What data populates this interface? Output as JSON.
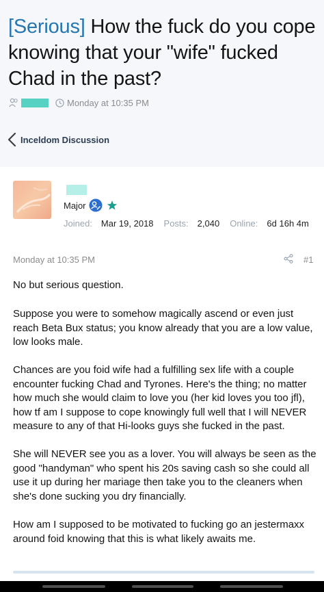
{
  "thread": {
    "prefix": "[Serious]",
    "title": " How the fuck do you cope knowing that your \"wife\" fucked Chad in the past?",
    "date": "Monday at 10:35 PM"
  },
  "breadcrumb": {
    "label": "Inceldom Discussion"
  },
  "author": {
    "rank": "Major",
    "stats": [
      {
        "label": "Joined:",
        "value": "Mar 19, 2018"
      },
      {
        "label": "Posts:",
        "value": "2,040"
      },
      {
        "label": "Online:",
        "value": "6d 16h 4m"
      }
    ]
  },
  "post": {
    "date": "Monday at 10:35 PM",
    "number": "#1",
    "paragraphs": [
      "No but serious question.",
      "Suppose you were to somehow magically ascend or even just reach Beta Bux status; you know already that you are a low value, low looks male.",
      "Chances are you foid wife had a fulfilling sex life with a couple encounter fucking Chad and Tyrones. Here's the thing; no matter how much she would claim to love you (her kid loves you too jfl), how tf am I suppose to cope knowingly full well that I will NEVER measure to any of that Hi-looks guys she fucked in the past.",
      "She will NEVER see you as a lover. You will always be seen as the good \"handyman\" who spent his 20s saving cash so she could all use it up during her mariage then take you to the cleaners when she's done sucking you dry financially.",
      "How am I supposed to be motivated to fucking go an jestermaxx around foid knowing that this is what likely awaits me."
    ]
  },
  "colors": {
    "accent": "#2577b1",
    "censor": "#56d1c2",
    "header_bg": "#f5f7fb",
    "star": "#1b9e8e"
  },
  "icons": [
    "user-icon",
    "clock-icon",
    "chevron-left-icon",
    "avatar-image",
    "rank-badge-icon",
    "star-icon",
    "share-icon"
  ]
}
